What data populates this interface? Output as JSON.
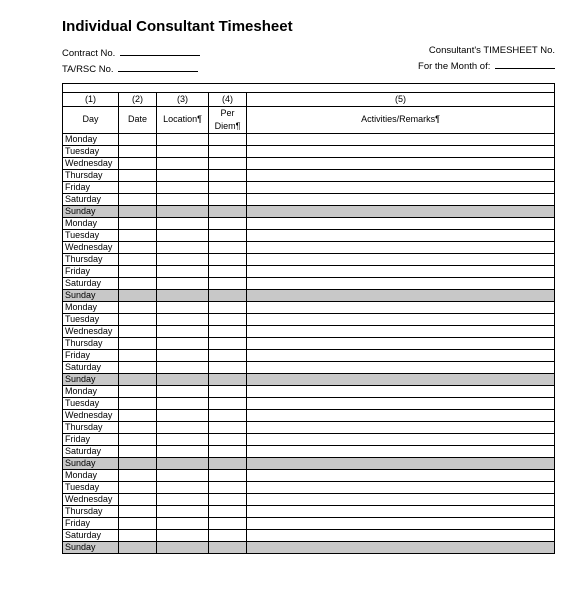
{
  "title": "Individual Consultant Timesheet",
  "meta": {
    "contract_label": "Contract No.",
    "ta_label": "TA/RSC No.",
    "timesheet_label": "Consultant's TIMESHEET No.",
    "month_label": "For the Month of:"
  },
  "headers": {
    "c1_num": "(1)",
    "c1_lbl": "Day",
    "c2_num": "(2)",
    "c2_lbl": "Date",
    "c3_num": "(3)",
    "c3_lbl": "Location¶",
    "c4_num": "(4)",
    "c4_lbl_a": "Per",
    "c4_lbl_b": "Diem¶",
    "c5_num": "(5)",
    "c5_lbl": "Activities/Remarks¶"
  },
  "rows": [
    {
      "day": "Monday",
      "shaded": false
    },
    {
      "day": "Tuesday",
      "shaded": false
    },
    {
      "day": "Wednesday",
      "shaded": false
    },
    {
      "day": "Thursday",
      "shaded": false
    },
    {
      "day": "Friday",
      "shaded": false
    },
    {
      "day": "Saturday",
      "shaded": false
    },
    {
      "day": "Sunday",
      "shaded": true
    },
    {
      "day": "Monday",
      "shaded": false
    },
    {
      "day": "Tuesday",
      "shaded": false
    },
    {
      "day": "Wednesday",
      "shaded": false
    },
    {
      "day": "Thursday",
      "shaded": false
    },
    {
      "day": "Friday",
      "shaded": false
    },
    {
      "day": "Saturday",
      "shaded": false
    },
    {
      "day": "Sunday",
      "shaded": true
    },
    {
      "day": "Monday",
      "shaded": false
    },
    {
      "day": "Tuesday",
      "shaded": false
    },
    {
      "day": "Wednesday",
      "shaded": false
    },
    {
      "day": "Thursday",
      "shaded": false
    },
    {
      "day": "Friday",
      "shaded": false
    },
    {
      "day": "Saturday",
      "shaded": false
    },
    {
      "day": "Sunday",
      "shaded": true
    },
    {
      "day": "Monday",
      "shaded": false
    },
    {
      "day": "Tuesday",
      "shaded": false
    },
    {
      "day": "Wednesday",
      "shaded": false
    },
    {
      "day": "Thursday",
      "shaded": false
    },
    {
      "day": "Friday",
      "shaded": false
    },
    {
      "day": "Saturday",
      "shaded": false
    },
    {
      "day": "Sunday",
      "shaded": true
    },
    {
      "day": "Monday",
      "shaded": false
    },
    {
      "day": "Tuesday",
      "shaded": false
    },
    {
      "day": "Wednesday",
      "shaded": false
    },
    {
      "day": "Thursday",
      "shaded": false
    },
    {
      "day": "Friday",
      "shaded": false
    },
    {
      "day": "Saturday",
      "shaded": false
    },
    {
      "day": "Sunday",
      "shaded": true
    }
  ]
}
